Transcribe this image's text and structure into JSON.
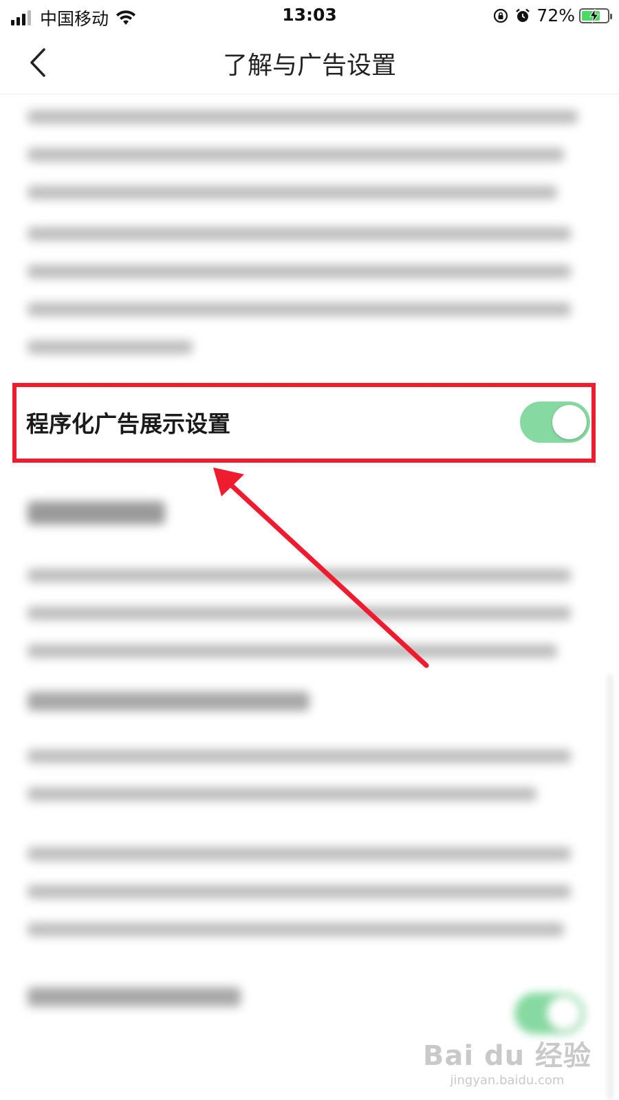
{
  "status_bar": {
    "carrier": "中国移动",
    "time": "13:03",
    "battery_percent": "72%",
    "battery_level": 0.72,
    "signal_bars": 3,
    "icons": [
      "signal-icon",
      "wifi-icon",
      "rotation-lock-icon",
      "alarm-icon",
      "battery-charging-icon"
    ]
  },
  "nav": {
    "title": "了解与广告设置",
    "back_icon": "chevron-left-icon"
  },
  "setting": {
    "label": "程序化广告展示设置",
    "enabled": true
  },
  "second_toggle_enabled": true,
  "colors": {
    "toggle_on": "#86d9a0",
    "highlight": "#ee1c2e",
    "background": "#ffffff"
  },
  "watermark": {
    "brand": "Bai du 经验",
    "url": "jingyan.baidu.com"
  }
}
